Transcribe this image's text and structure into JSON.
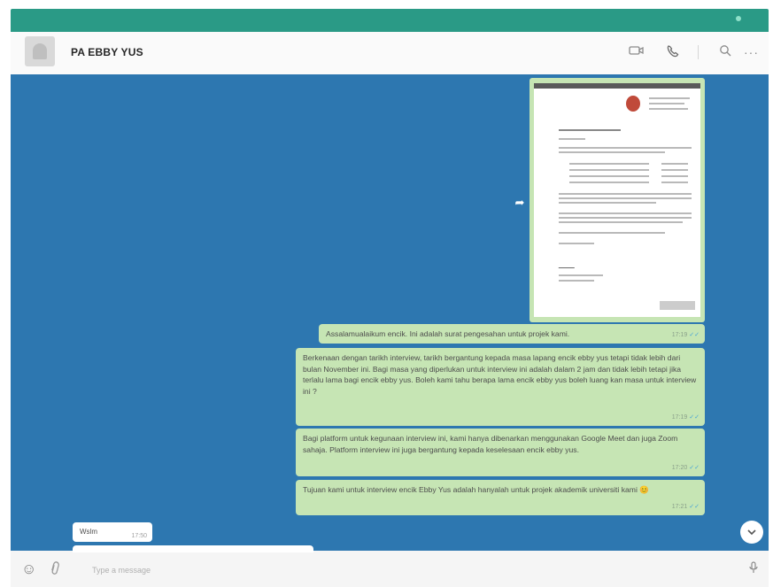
{
  "chat": {
    "contact_name": "PA EBBY YUS",
    "messages": [
      {
        "type": "image",
        "direction": "out",
        "caption": ""
      },
      {
        "direction": "out",
        "text": "Assalamualaikum encik. Ini adalah surat pengesahan untuk projek kami.",
        "time": "17:19"
      },
      {
        "direction": "out",
        "text": "Berkenaan dengan tarikh interview, tarikh bergantung kepada masa lapang encik ebby yus tetapi tidak lebih dari bulan November ini. Bagi masa yang diperlukan untuk interview ini adalah dalam 2 jam dan tidak lebih tetapi jika terlalu lama bagi encik ebby yus. Boleh kami tahu berapa lama encik ebby yus boleh luang kan masa untuk interview ini ?",
        "time": "17:19"
      },
      {
        "direction": "out",
        "text": "Bagi platform untuk kegunaan interview ini, kami hanya dibenarkan menggunakan Google Meet dan juga Zoom sahaja. Platform interview ini juga bergantung kepada keselesaan encik ebby yus.",
        "time": "17:20"
      },
      {
        "direction": "out",
        "text": "Tujuan kami untuk interview encik Ebby Yus adalah hanyalah untuk projek akademik universiti kami",
        "emoji": "😊",
        "time": "17:21"
      },
      {
        "direction": "in",
        "text": "Wslm",
        "time": "17:50"
      }
    ]
  },
  "composer": {
    "placeholder": "Type a message"
  },
  "icons": {
    "video": "video-call-icon",
    "call": "phone-call-icon",
    "search": "search-icon",
    "menu": "more-options-icon",
    "emoji": "emoji-icon",
    "attach": "attach-icon",
    "mic": "microphone-icon",
    "forward": "forward-icon",
    "scroll": "chevron-down-icon"
  },
  "colors": {
    "accent": "#2a9a86",
    "chat_background": "#2d77b0",
    "outgoing_bubble": "#c6e5b4",
    "incoming_bubble": "#ffffff",
    "read_ticks": "#46a3d6"
  }
}
